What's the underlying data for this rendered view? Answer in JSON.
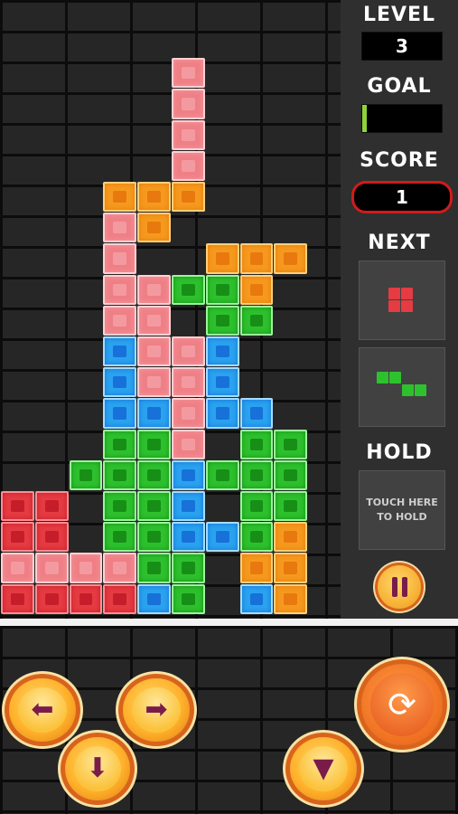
{
  "sidebar": {
    "level_label": "LEVEL",
    "level_value": "3",
    "goal_label": "GOAL",
    "goal_progress": 0.06,
    "score_label": "SCORE",
    "score_value": "1",
    "next_label": "NEXT",
    "hold_label": "HOLD",
    "hold_hint_line1": "TOUCH HERE",
    "hold_hint_line2": "TO HOLD",
    "pause_icon": "pause-icon"
  },
  "next_pieces": [
    {
      "shape": "O",
      "color": "red"
    },
    {
      "shape": "Z",
      "color": "green"
    }
  ],
  "board": {
    "columns": 11,
    "rows": 20,
    "cells": [
      [
        0,
        2,
        "pink"
      ],
      [
        1,
        2,
        "pink"
      ],
      [
        2,
        2,
        "pink"
      ],
      [
        3,
        2,
        "pink"
      ],
      [
        4,
        2,
        "pink"
      ],
      [
        5,
        1,
        "orange"
      ],
      [
        5,
        2,
        "orange"
      ],
      [
        5,
        3,
        "orange"
      ],
      [
        6,
        2,
        "orange"
      ],
      [
        6,
        1,
        "pink"
      ],
      [
        7,
        1,
        "pink"
      ],
      [
        8,
        1,
        "pink"
      ],
      [
        9,
        1,
        "pink"
      ],
      [
        10,
        1,
        "pink"
      ],
      [
        7,
        3,
        "pink"
      ],
      [
        8,
        3,
        "pink"
      ],
      [
        9,
        3,
        "pink"
      ],
      [
        10,
        3,
        "pink"
      ],
      [
        8,
        6,
        "orange"
      ],
      [
        8,
        7,
        "orange"
      ],
      [
        8,
        8,
        "orange"
      ],
      [
        9,
        7,
        "orange"
      ],
      [
        9,
        5,
        "green"
      ],
      [
        9,
        6,
        "green"
      ],
      [
        10,
        6,
        "green"
      ],
      [
        10,
        7,
        "green"
      ],
      [
        11,
        1,
        "blue"
      ],
      [
        12,
        1,
        "blue"
      ],
      [
        13,
        1,
        "blue"
      ],
      [
        13,
        2,
        "blue"
      ],
      [
        11,
        4,
        "pink"
      ],
      [
        12,
        4,
        "pink"
      ],
      [
        13,
        4,
        "pink"
      ],
      [
        14,
        4,
        "pink"
      ],
      [
        11,
        5,
        "blue"
      ],
      [
        12,
        5,
        "blue"
      ],
      [
        13,
        5,
        "blue"
      ],
      [
        13,
        6,
        "blue"
      ],
      [
        13,
        7,
        "blue"
      ],
      [
        14,
        1,
        "green"
      ],
      [
        14,
        2,
        "green"
      ],
      [
        14,
        3,
        "green"
      ],
      [
        15,
        2,
        "green"
      ],
      [
        15,
        2,
        "green"
      ],
      [
        15,
        3,
        "green"
      ],
      [
        15,
        5,
        "green"
      ],
      [
        16,
        3,
        "green"
      ],
      [
        17,
        3,
        "green"
      ],
      [
        16,
        4,
        "green"
      ],
      [
        15,
        0,
        "green"
      ],
      [
        15,
        1,
        "green"
      ],
      [
        16,
        1,
        "green"
      ],
      [
        17,
        1,
        "green"
      ],
      [
        15,
        4,
        "blue"
      ],
      [
        16,
        4,
        "blue"
      ],
      [
        17,
        4,
        "blue"
      ],
      [
        17,
        5,
        "blue"
      ],
      [
        17,
        6,
        "blue"
      ],
      [
        15,
        5,
        "green"
      ],
      [
        15,
        6,
        "green"
      ],
      [
        16,
        6,
        "green"
      ],
      [
        17,
        7,
        "green"
      ],
      [
        14,
        7,
        "green"
      ],
      [
        14,
        8,
        "green"
      ],
      [
        15,
        8,
        "green"
      ],
      [
        16,
        8,
        "green"
      ],
      [
        16,
        9,
        "green"
      ],
      [
        17,
        8,
        "orange"
      ],
      [
        18,
        8,
        "orange"
      ],
      [
        19,
        8,
        "orange"
      ],
      [
        18,
        7,
        "orange"
      ],
      [
        18,
        4,
        "green"
      ],
      [
        18,
        5,
        "green"
      ],
      [
        19,
        5,
        "green"
      ],
      [
        19,
        4,
        "blue"
      ],
      [
        19,
        7,
        "blue"
      ],
      [
        16,
        0,
        "red"
      ],
      [
        16,
        1,
        "red"
      ],
      [
        17,
        0,
        "red"
      ],
      [
        17,
        1,
        "red"
      ],
      [
        18,
        0,
        "pink"
      ],
      [
        18,
        1,
        "pink"
      ],
      [
        18,
        2,
        "pink"
      ],
      [
        18,
        3,
        "pink"
      ],
      [
        19,
        0,
        "red"
      ],
      [
        19,
        1,
        "red"
      ],
      [
        19,
        2,
        "red"
      ],
      [
        19,
        3,
        "red"
      ]
    ]
  },
  "controls": {
    "left_icon": "arrow-left-icon",
    "right_icon": "arrow-right-icon",
    "down_icon": "arrow-down-icon",
    "drop_icon": "hard-drop-icon",
    "rotate_icon": "rotate-icon"
  },
  "colors": {
    "red": "#e53b43",
    "pink": "#ef7f86",
    "orange": "#f59a1e",
    "green": "#2ec12e",
    "blue": "#2aa3ef",
    "goal_bar": "#8fd33c",
    "score_border": "#d21b1b"
  }
}
